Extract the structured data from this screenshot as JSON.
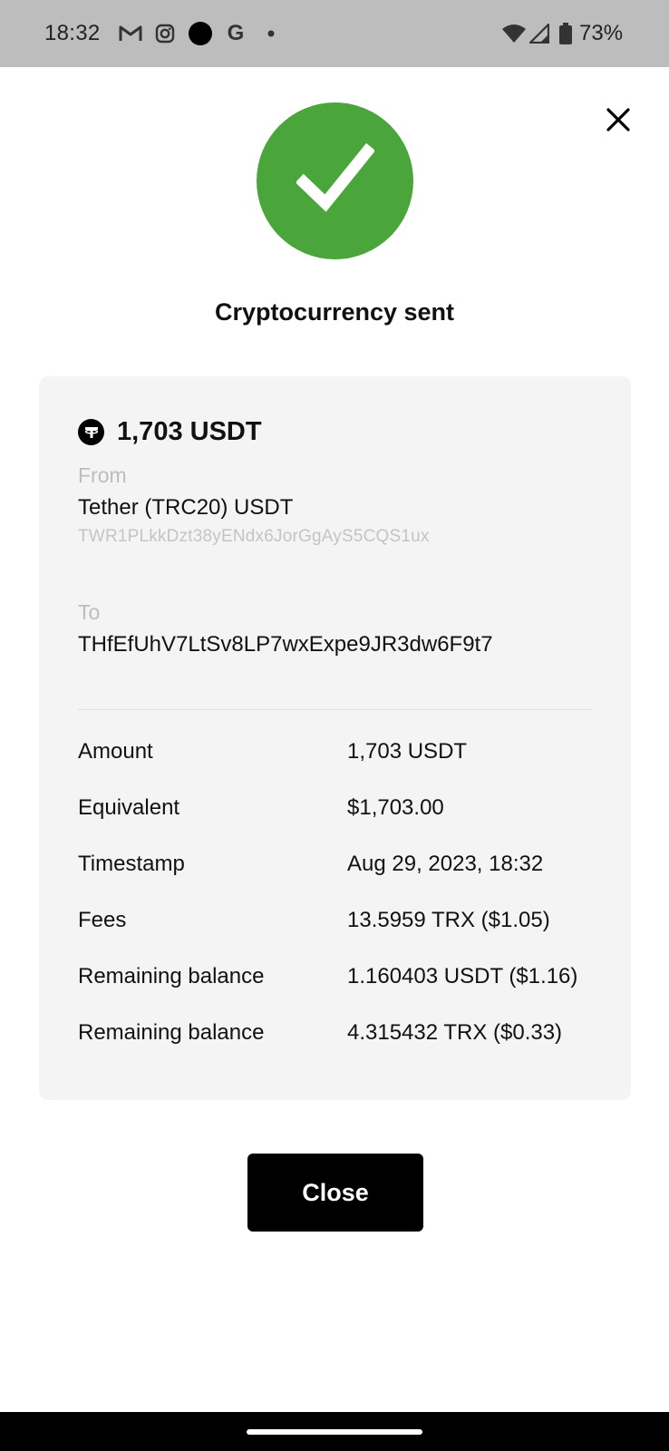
{
  "status_bar": {
    "time": "18:32",
    "battery_percent": "73%",
    "icons": [
      "gmail-icon",
      "instagram-icon",
      "dot-app-icon",
      "google-icon",
      "more-notifications-icon",
      "wifi-icon",
      "signal-icon",
      "battery-icon"
    ],
    "google_glyph": "G"
  },
  "header": {
    "close_icon": "close-icon"
  },
  "success": {
    "icon": "check-icon",
    "color": "#4aa53a",
    "title": "Cryptocurrency sent"
  },
  "transaction": {
    "amount": "1,703 USDT",
    "asset_icon": "tether-icon",
    "from_label": "From",
    "from_wallet": "Tether (TRC20) USDT",
    "from_address": "TWR1PLkkDzt38yENdx6JorGgAyS5CQS1ux",
    "to_label": "To",
    "to_address": "THfEfUhV7LtSv8LP7wxExpe9JR3dw6F9t7"
  },
  "details": [
    {
      "label": "Amount",
      "value": "1,703 USDT"
    },
    {
      "label": "Equivalent",
      "value": "$1,703.00"
    },
    {
      "label": "Timestamp",
      "value": "Aug 29, 2023, 18:32"
    },
    {
      "label": "Fees",
      "value": "13.5959 TRX ($1.05)"
    },
    {
      "label": "Remaining balance",
      "value": "1.160403 USDT ($1.16)"
    },
    {
      "label": "Remaining balance",
      "value": "4.315432 TRX ($0.33)"
    }
  ],
  "actions": {
    "close_label": "Close"
  }
}
